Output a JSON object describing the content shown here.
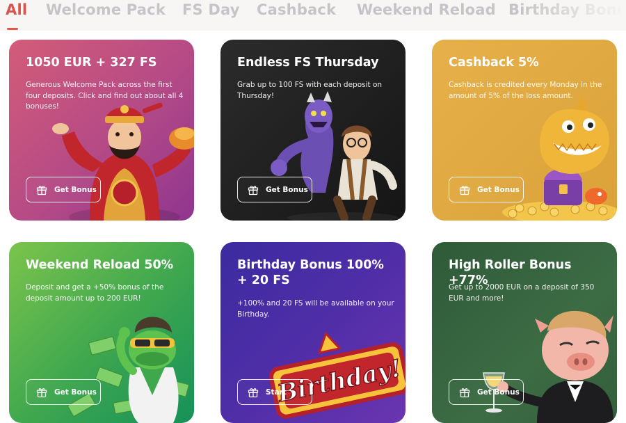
{
  "tabs": [
    {
      "label": "All",
      "active": true
    },
    {
      "label": "Welcome Pack",
      "active": false
    },
    {
      "label": "FS Day",
      "active": false
    },
    {
      "label": "Cashback",
      "active": false
    },
    {
      "label": "Weekend Reload",
      "active": false
    },
    {
      "label": "Birthday Bonus",
      "active": false
    }
  ],
  "colors": {
    "accent": "#e2574c",
    "tab_inactive": "#c6c4c8",
    "tab_bar_bg": "#f7f6f4"
  },
  "cards": [
    {
      "title": "1050 EUR + 327 FS",
      "description": "Generous Welcome Pack across the first four deposits. Click and find out about all 4 bonuses!",
      "button_label": "Get Bonus",
      "button_icon": "gift-icon",
      "art": "fortune-god-illustration",
      "gradient": [
        "#d35c78",
        "#8f3590"
      ]
    },
    {
      "title": "Endless FS Thursday",
      "description": "Grab up to 100 FS with each deposit on Thursday!",
      "button_label": "Get Bonus",
      "button_icon": "gift-icon",
      "art": "cartoon-characters-illustration",
      "gradient": [
        "#2c2c2c",
        "#151515"
      ]
    },
    {
      "title": "Cashback 5%",
      "description": "Cashback is credited every Monday in the amount of 5% of the loss amount.",
      "button_label": "Get Bonus",
      "button_icon": "gift-icon",
      "art": "shark-treasure-illustration",
      "gradient": [
        "#e7b04a",
        "#daa238"
      ]
    },
    {
      "title": "Weekend Reload 50%",
      "description": "Deposit and get a +50% bonus of the deposit amount up to 200 EUR!",
      "button_label": "Get Bonus",
      "button_icon": "gift-icon",
      "art": "frog-money-illustration",
      "gradient": [
        "#7cc44c",
        "#16915a"
      ]
    },
    {
      "title": "Birthday Bonus 100% + 20 FS",
      "description": "+100% and 20 FS will be available on your Birthday.",
      "button_label": "Start",
      "button_icon": "gift-icon",
      "art": "birthday-sign-illustration",
      "art_text": "Birthday!",
      "gradient": [
        "#3c2ba0",
        "#6a35b0"
      ]
    },
    {
      "title": "High Roller Bonus +77%",
      "description": "Get up to 2000 EUR on a deposit of 350 EUR and more!",
      "button_label": "Get Bonus",
      "button_icon": "gift-icon",
      "art": "pig-tuxedo-illustration",
      "gradient": [
        "#2f5a38",
        "#335e3b"
      ]
    }
  ]
}
